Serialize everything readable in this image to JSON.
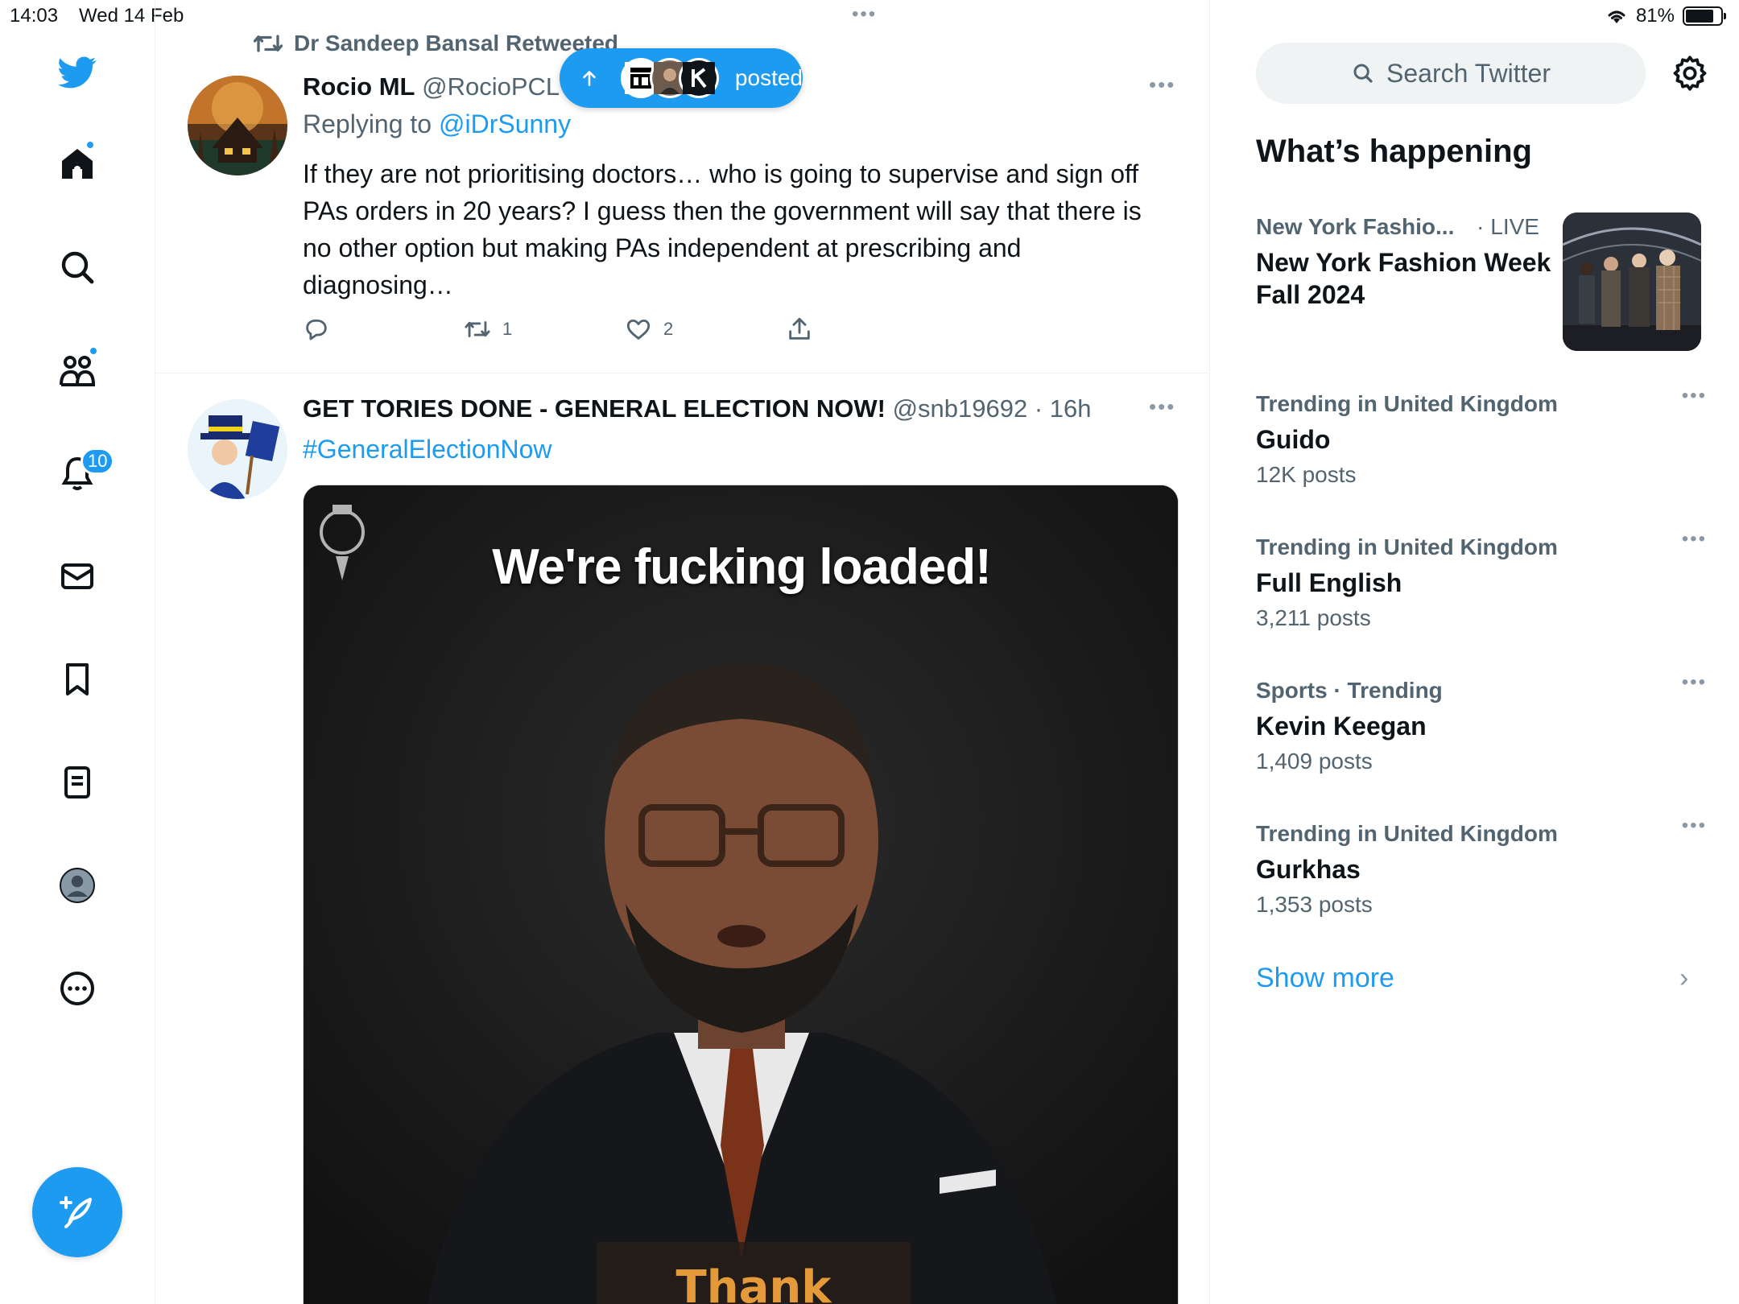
{
  "status": {
    "time": "14:03",
    "date": "Wed 14 Feb",
    "battery": "81%",
    "battery_level": 0.81
  },
  "nav": {
    "notifications_badge": "10"
  },
  "timeline": {
    "tweet1": {
      "retweeted_by": "Dr Sandeep Bansal Retweeted",
      "name": "Rocio ML",
      "handle": "@RocioPCL",
      "replying_prefix": "Replying to",
      "replying_to": "@iDrSunny",
      "text": "If they are not prioritising doctors… who is going to supervise and sign off PAs orders in 20 years? I guess then the government will say that there is no other option but making PAs independent at prescribing and diagnosing…",
      "retweets": "1",
      "likes": "2"
    },
    "posted_pill": {
      "label": "posted"
    },
    "tweet2": {
      "name": "GET TORIES DONE - GENERAL ELECTION NOW!",
      "handle_time": "@snb19692 · 16h",
      "hashtag": "#GeneralElectionNow",
      "media_caption": "We're fucking loaded!",
      "media_subtitle": "Thank Fraud"
    }
  },
  "sidebar": {
    "search_placeholder": "Search Twitter",
    "whats_happening": "What’s happening",
    "featured": {
      "category": "New York Fashio...",
      "status": "· LIVE",
      "title": "New York Fashion Week Fall 2024"
    },
    "trends": [
      {
        "meta": "Trending in United Kingdom",
        "name": "Guido",
        "count": "12K posts"
      },
      {
        "meta": "Trending in United Kingdom",
        "name": "Full English",
        "count": "3,211 posts"
      },
      {
        "meta": "Sports · Trending",
        "name": "Kevin Keegan",
        "count": "1,409 posts"
      },
      {
        "meta": "Trending in United Kingdom",
        "name": "Gurkhas",
        "count": "1,353 posts"
      }
    ],
    "show_more": "Show more"
  },
  "colors": {
    "accent": "#1d9bf0",
    "text_secondary": "#536471"
  }
}
